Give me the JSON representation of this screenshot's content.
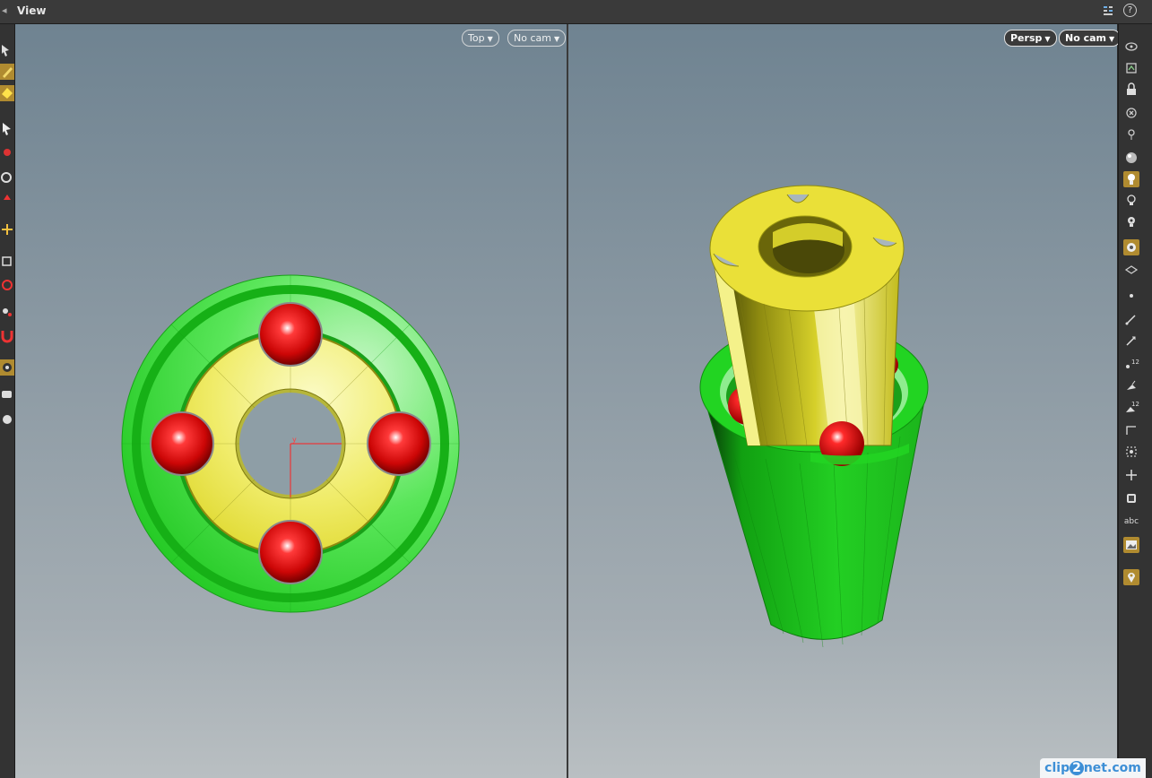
{
  "titlebar": {
    "title": "View",
    "help_label": "?"
  },
  "left_viewport": {
    "view_menu": "Top",
    "camera_menu": "No cam",
    "axis_label": "y"
  },
  "right_viewport": {
    "view_menu": "Persp",
    "camera_menu": "No cam"
  },
  "right_toolbar": {
    "labels": {
      "count_a": "12",
      "count_b": "12",
      "text_tool": "abc"
    }
  },
  "colors": {
    "ring_green": "#22cc22",
    "ring_yellow": "#e6d92a",
    "sphere_red": "#d01010",
    "viewport_top": "#6f8391",
    "viewport_bottom": "#b9bfc2"
  },
  "watermark": {
    "prefix": "clip",
    "mid": "2",
    "suffix": "net.com"
  }
}
